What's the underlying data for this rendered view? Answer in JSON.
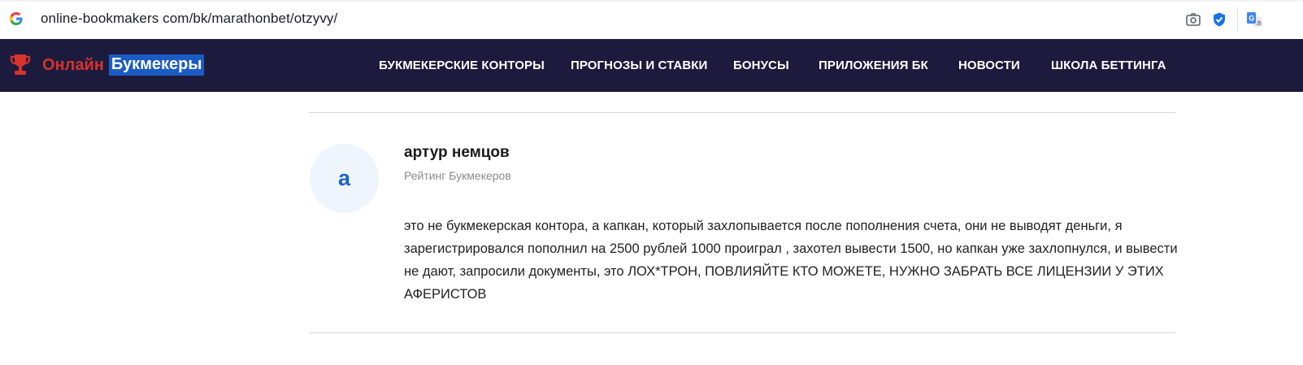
{
  "browser": {
    "url": "online-bookmakers com/bk/marathonbet/otzyvy/"
  },
  "site": {
    "logo_word1": "Онлайн",
    "logo_word2": "Букмекеры",
    "nav": [
      "БУКМЕКЕРСКИЕ КОНТОРЫ",
      "ПРОГНОЗЫ И СТАВКИ",
      "БОНУСЫ",
      "ПРИЛОЖЕНИЯ БК",
      "НОВОСТИ",
      "ШКОЛА БЕТТИНГА"
    ]
  },
  "review": {
    "avatar_letter": "a",
    "author": "артур немцов",
    "subtitle": "Рейтинг Букмекеров",
    "text": "это не букмекерская контора, а капкан, который захлопывается после пополнения счета, они не выводят деньги, я зарегистрировался пополнил на 2500 рублей 1000 проиграл , захотел вывести 1500, но капкан уже захлопнулся, и вывести не дают, запросили документы, это ЛОХ*ТРОН, ПОВЛИЯЙТЕ КТО МОЖЕТЕ, НУЖНО ЗАБРАТЬ ВСЕ ЛИЦЕНЗИИ У ЭТИХ АФЕРИСТОВ"
  },
  "colors": {
    "header_bg": "#1c1b3d",
    "logo_red": "#d8322c",
    "logo_blue": "#1b5cc4",
    "avatar_bg": "#eff5fd",
    "avatar_letter": "#1b64c8"
  },
  "icons": [
    "google-favicon-icon",
    "camera-icon",
    "shield-check-icon",
    "translate-icon",
    "trophy-icon"
  ]
}
